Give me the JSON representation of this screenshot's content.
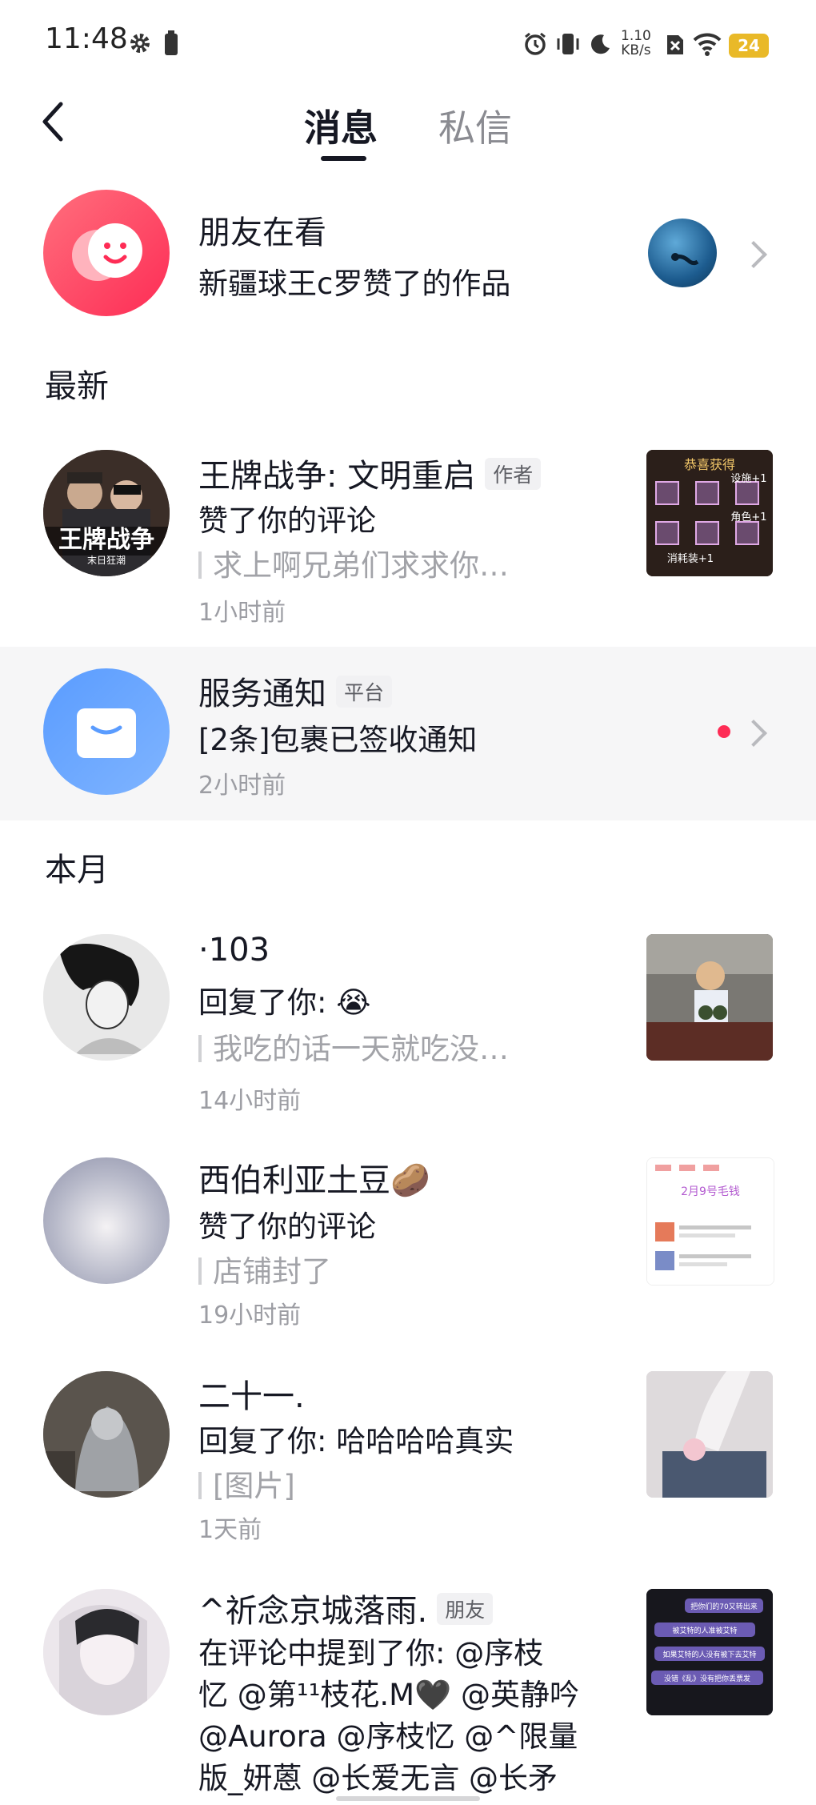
{
  "status_bar": {
    "time": "11:48",
    "net_speed_value": "1.10",
    "net_speed_unit": "KB/s",
    "battery": "24"
  },
  "header": {
    "tabs": [
      {
        "label": "消息",
        "active": true
      },
      {
        "label": "私信",
        "active": false
      }
    ]
  },
  "friends_watching": {
    "title": "朋友在看",
    "subtitle": "新疆球王c罗赞了的作品"
  },
  "sections": {
    "latest": "最新",
    "this_month": "本月"
  },
  "messages": [
    {
      "name": "王牌战争: 文明重启",
      "badge": "作者",
      "action": "赞了你的评论",
      "quote": "求上啊兄弟们求求你…",
      "time": "1小时前"
    },
    {
      "name": "服务通知",
      "badge": "平台",
      "action": "[2条]包裹已签收通知",
      "time": "2小时前",
      "unread": true
    },
    {
      "name": "·103",
      "action": "回复了你:",
      "action_emoji": "😭",
      "quote": "我吃的话一天就吃没…",
      "time": "14小时前"
    },
    {
      "name": "西伯利亚土豆",
      "name_emoji": "🥔",
      "action": "赞了你的评论",
      "quote": "店铺封了",
      "time": "19小时前"
    },
    {
      "name": "二十一.",
      "action": "回复了你: 哈哈哈哈真实",
      "quote": "[图片]",
      "time": "1天前"
    },
    {
      "name": "^祈念京城落雨.",
      "badge": "朋友",
      "action_lines": [
        "在评论中提到了你: @序枝",
        "忆 @第¹¹枝花.M🖤 @英静吟",
        " @Aurora @序枝忆 @^限量",
        "版_妍蒽 @长爱无言 @长矛"
      ]
    }
  ],
  "thumbs": {
    "game_title": "恭喜获得",
    "game_tags": [
      "设施+1",
      "角色+1",
      "消耗装+1"
    ],
    "post_title": "2月9号毛钱",
    "chat_bubbles": [
      "把你们的70又转出来",
      "被艾特的人准被艾特",
      "如果艾特的人没有被下去艾特",
      "没错《乱》没有把你丢票发"
    ],
    "game_logo": "王牌战争",
    "game_logo_sub": "末日狂潮"
  },
  "colors": {
    "accent_red": "#fe2c55",
    "text_primary": "#161823",
    "text_secondary": "#a2a3a8"
  }
}
